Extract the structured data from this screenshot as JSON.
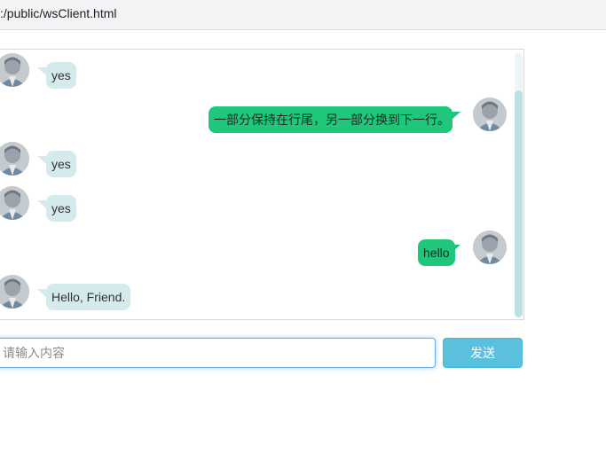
{
  "address_bar": {
    "url": ":/public/wsClient.html"
  },
  "messages": [
    {
      "side": "left",
      "text": "yes",
      "avatar_icon": "user-avatar-icon"
    },
    {
      "side": "right",
      "text": "一部分保持在行尾，另一部分换到下一行。",
      "avatar_icon": "user-avatar-icon"
    },
    {
      "side": "left",
      "text": "yes",
      "avatar_icon": "user-avatar-icon"
    },
    {
      "side": "left",
      "text": "yes",
      "avatar_icon": "user-avatar-icon"
    },
    {
      "side": "right",
      "text": "hello",
      "avatar_icon": "user-avatar-icon"
    },
    {
      "side": "left",
      "text": "Hello, Friend.",
      "avatar_icon": "user-avatar-icon"
    }
  ],
  "composer": {
    "placeholder": "请输入内容",
    "value": "",
    "send_label": "发送"
  },
  "colors": {
    "incoming_bubble": "#d4eaec",
    "outgoing_bubble": "#1ec77a",
    "send_button": "#5bc0de",
    "input_focus_border": "#66afe9"
  }
}
